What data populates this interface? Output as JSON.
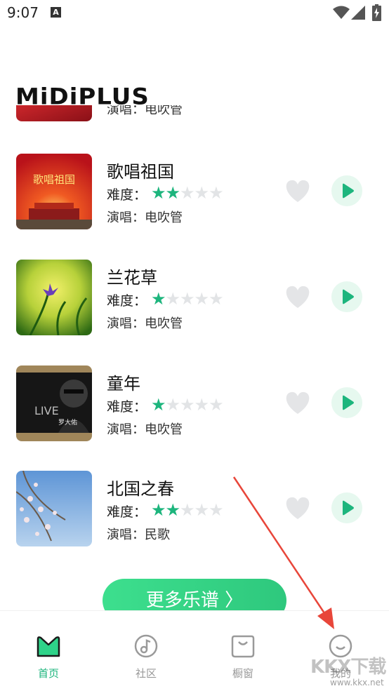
{
  "status_bar": {
    "time": "9:07",
    "notification_icon": "A"
  },
  "header": {
    "logo": "MiDiPLUS"
  },
  "songs": [
    {
      "title": "",
      "difficulty_label": "难度：",
      "difficulty": 0,
      "singer_label": "演唱：",
      "singer": "电吹管",
      "cover_color": "#a5141c"
    },
    {
      "title": "歌唱祖国",
      "difficulty_label": "难度：",
      "difficulty": 2,
      "singer_label": "演唱：",
      "singer": "电吹管",
      "cover_color": "#d81e1e",
      "cover_text": "歌唱祖国"
    },
    {
      "title": "兰花草",
      "difficulty_label": "难度：",
      "difficulty": 1,
      "singer_label": "演唱：",
      "singer": "电吹管",
      "cover_color": "#7ab82c"
    },
    {
      "title": "童年",
      "difficulty_label": "难度：",
      "difficulty": 1,
      "singer_label": "演唱：",
      "singer": "电吹管",
      "cover_color": "#2a2a2a",
      "cover_text": "罗大佑"
    },
    {
      "title": "北国之春",
      "difficulty_label": "难度：",
      "difficulty": 2,
      "singer_label": "演唱：",
      "singer": "民歌",
      "cover_color": "#7aa6d8"
    }
  ],
  "more_button": {
    "label": "更多乐谱 〉"
  },
  "tabs": [
    {
      "label": "首页",
      "icon": "home-m-icon",
      "active": true
    },
    {
      "label": "社区",
      "icon": "music-note-icon",
      "active": false
    },
    {
      "label": "橱窗",
      "icon": "shopping-bag-icon",
      "active": false
    },
    {
      "label": "我的",
      "icon": "smile-face-icon",
      "active": false
    }
  ],
  "watermark": {
    "text": "KKX下载",
    "url": "www.kkx.net"
  },
  "colors": {
    "accent": "#1db57d",
    "play_bg": "#e6f8ef",
    "heart": "#e4e5e7",
    "arrow": "#e8463a"
  }
}
